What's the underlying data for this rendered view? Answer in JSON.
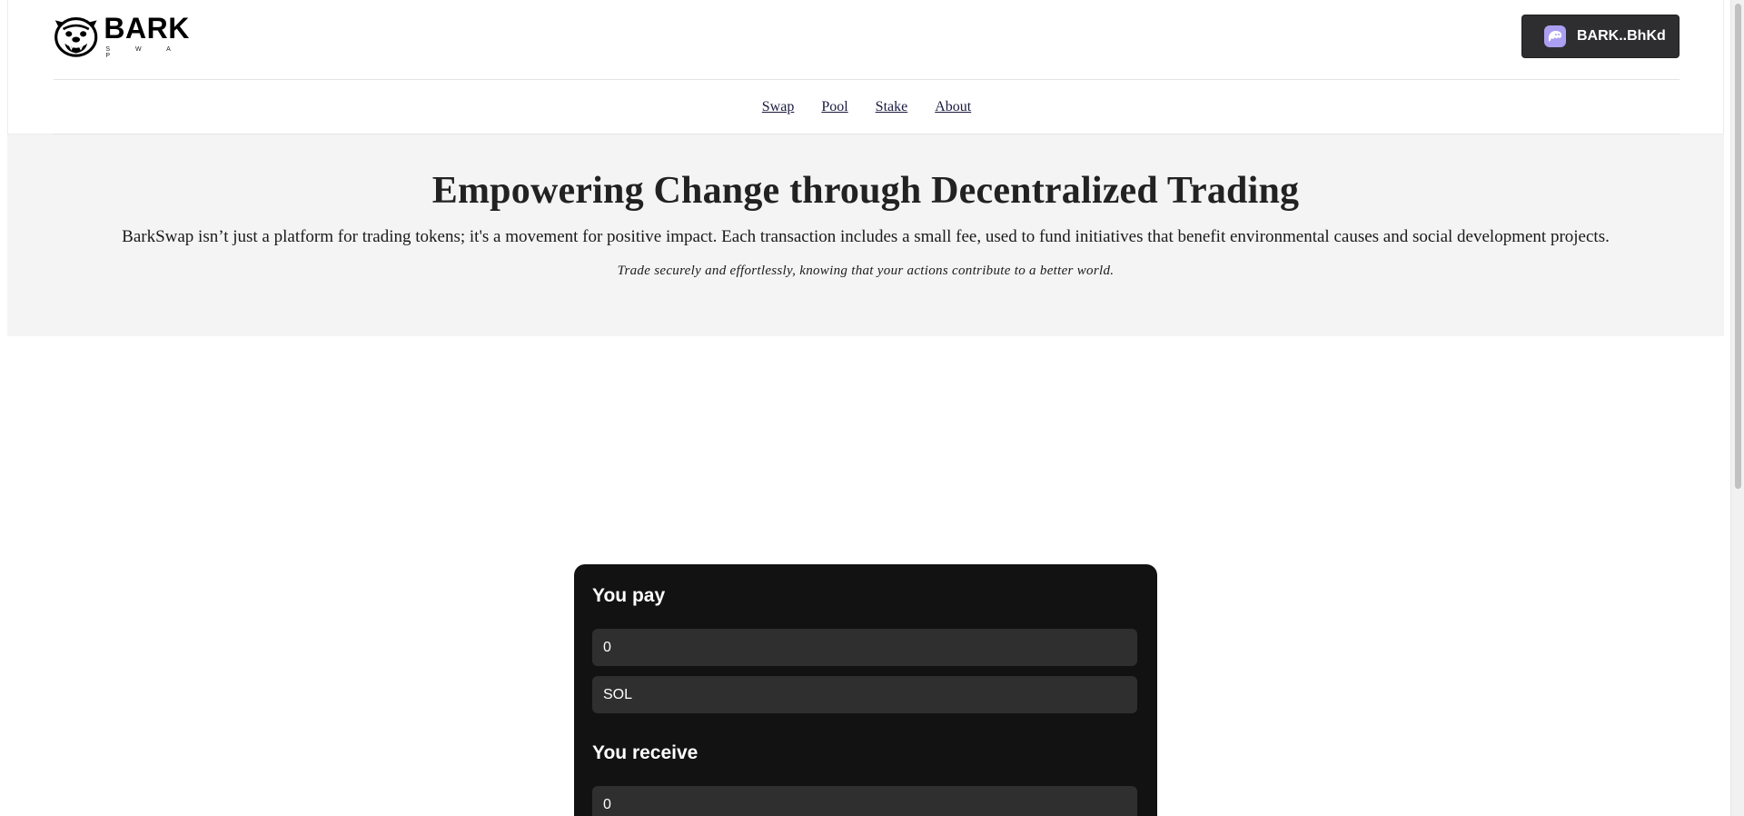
{
  "brand": {
    "name": "BARK",
    "sub": "S W A P"
  },
  "wallet": {
    "label": "BARK..BhKd"
  },
  "nav": {
    "items": [
      {
        "label": "Swap"
      },
      {
        "label": "Pool"
      },
      {
        "label": "Stake"
      },
      {
        "label": "About"
      }
    ]
  },
  "hero": {
    "title": "Empowering Change through Decentralized Trading",
    "lead": "BarkSwap isn’t just a platform for trading tokens; it's a movement for positive impact. Each transaction includes a small fee, used to fund initiatives that benefit environmental causes and social development projects.",
    "tagline": "Trade securely and effortlessly, knowing that your actions contribute to a better world."
  },
  "swap": {
    "pay_label": "You pay",
    "pay_amount": "0",
    "pay_token": "SOL",
    "receive_label": "You receive",
    "receive_amount": "0"
  },
  "colors": {
    "wallet_bg": "#2e2e30",
    "wallet_icon": "#ab9ff2",
    "card_bg": "#131213",
    "field_bg": "#2f2f30",
    "hero_bg": "#f4f4f4"
  },
  "icons": {
    "logo": "bulldog-logo-icon",
    "wallet": "phantom-ghost-icon"
  }
}
